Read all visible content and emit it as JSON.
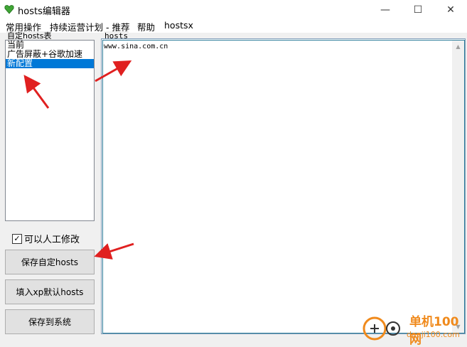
{
  "window": {
    "title": "hosts编辑器",
    "minimize": "—",
    "maximize": "☐",
    "close": "✕"
  },
  "menu": [
    "常用操作",
    "持续运营计划 - 推荐",
    "帮助",
    "hostsx"
  ],
  "left_panel": {
    "group_label": "自定hosts表",
    "items": [
      {
        "label": "当前",
        "selected": false
      },
      {
        "label": "广告屏蔽+谷歌加速",
        "selected": false
      },
      {
        "label": "新配置",
        "selected": true
      }
    ]
  },
  "editor": {
    "label": "hosts",
    "content": "www.sina.com.cn"
  },
  "checkbox": {
    "label": "可以人工修改",
    "checked": true,
    "mark": "✓"
  },
  "buttons": {
    "save_custom": "保存自定hosts",
    "fill_xp": "填入xp默认hosts",
    "save_system": "保存到系统"
  },
  "watermark": {
    "brand": "单机100网",
    "url": "danji100.com"
  },
  "colors": {
    "selection": "#0078d7",
    "arrow": "#e02020",
    "watermark": "#f08a1c"
  }
}
